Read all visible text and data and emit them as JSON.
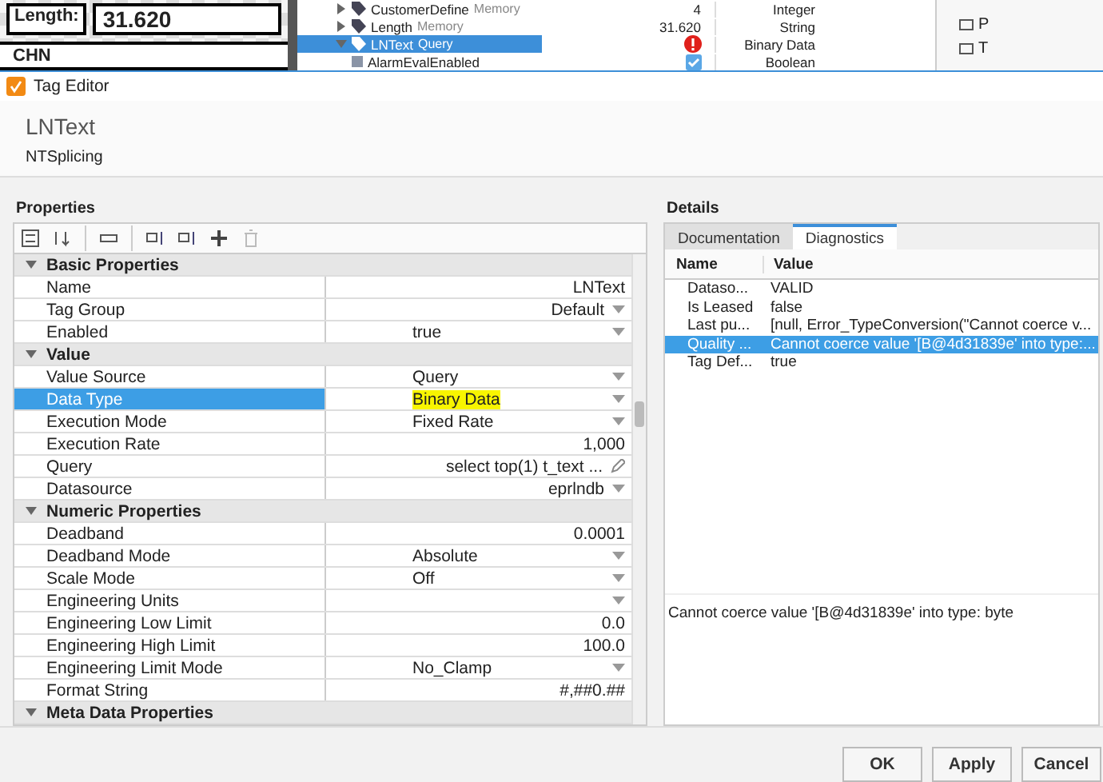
{
  "background": {
    "canvas": {
      "length_label": "Length:",
      "length_value": "31.620",
      "country": "CHN"
    },
    "tag_tree": [
      {
        "kind": "tag",
        "name": "CustomerDefine",
        "source": "Memory",
        "value": {
          "kind": "text",
          "text": "4"
        },
        "data_type": "Integer",
        "expanded": false,
        "selected": false
      },
      {
        "kind": "tag",
        "name": "Length",
        "source": "Memory",
        "value": {
          "kind": "text",
          "text": "31.620"
        },
        "data_type": "String",
        "expanded": false,
        "selected": false
      },
      {
        "kind": "tag",
        "name": "LNText",
        "source": "Query",
        "value": {
          "kind": "error"
        },
        "data_type": "Binary Data",
        "expanded": true,
        "selected": true
      },
      {
        "kind": "member",
        "name": "AlarmEvalEnabled",
        "value": {
          "kind": "checkbox",
          "checked": true
        },
        "data_type": "Boolean",
        "selected": false
      }
    ],
    "side_panel": [
      "P",
      "T"
    ]
  },
  "dialog": {
    "title": "Tag Editor",
    "tag_name": "LNText",
    "tag_path": "NTSplicing",
    "properties": {
      "title": "Properties",
      "rows": [
        {
          "kind": "section",
          "label": "Basic Properties",
          "expanded": true
        },
        {
          "kind": "text",
          "label": "Name",
          "value": "LNText",
          "selected": false,
          "highlighted": false
        },
        {
          "kind": "dropdown-right",
          "label": "Tag Group",
          "value": "Default",
          "selected": false,
          "highlighted": false
        },
        {
          "kind": "dropdown",
          "label": "Enabled",
          "value": "true",
          "selected": false,
          "highlighted": false
        },
        {
          "kind": "section",
          "label": "Value",
          "expanded": true
        },
        {
          "kind": "dropdown",
          "label": "Value Source",
          "value": "Query",
          "selected": false,
          "highlighted": false
        },
        {
          "kind": "dropdown",
          "label": "Data Type",
          "value": "Binary Data",
          "selected": true,
          "highlighted": true
        },
        {
          "kind": "dropdown",
          "label": "Execution Mode",
          "value": "Fixed Rate",
          "selected": false,
          "highlighted": false
        },
        {
          "kind": "text",
          "label": "Execution Rate",
          "value": "1,000",
          "selected": false,
          "highlighted": false
        },
        {
          "kind": "editable",
          "label": "Query",
          "value": "select  top(1) t_text ...",
          "selected": false,
          "highlighted": false
        },
        {
          "kind": "dropdown-right",
          "label": "Datasource",
          "value": "eprlndb",
          "selected": false,
          "highlighted": false
        },
        {
          "kind": "section",
          "label": "Numeric Properties",
          "expanded": true
        },
        {
          "kind": "text",
          "label": "Deadband",
          "value": "0.0001",
          "selected": false,
          "highlighted": false
        },
        {
          "kind": "dropdown",
          "label": "Deadband Mode",
          "value": "Absolute",
          "selected": false,
          "highlighted": false
        },
        {
          "kind": "dropdown",
          "label": "Scale Mode",
          "value": "Off",
          "selected": false,
          "highlighted": false
        },
        {
          "kind": "dropdown",
          "label": "Engineering Units",
          "selected": false,
          "highlighted": false
        },
        {
          "kind": "text",
          "label": "Engineering Low Limit",
          "value": "0.0",
          "selected": false,
          "highlighted": false
        },
        {
          "kind": "text",
          "label": "Engineering High Limit",
          "value": "100.0",
          "selected": false,
          "highlighted": false
        },
        {
          "kind": "dropdown",
          "label": "Engineering Limit Mode",
          "value": "No_Clamp",
          "selected": false,
          "highlighted": false
        },
        {
          "kind": "text",
          "label": "Format String",
          "value": "#,##0.##",
          "selected": false,
          "highlighted": false
        },
        {
          "kind": "section",
          "label": "Meta Data Properties",
          "expanded": true
        }
      ]
    },
    "details": {
      "title": "Details",
      "tabs": [
        {
          "label": "Documentation",
          "selected": false
        },
        {
          "label": "Diagnostics",
          "selected": true
        }
      ],
      "columns": [
        "Name",
        "Value"
      ],
      "rows": [
        {
          "name": "Dataso...",
          "value": "VALID",
          "selected": false
        },
        {
          "name": "Is Leased",
          "value": "false",
          "selected": false
        },
        {
          "name": "Last pu...",
          "value": "[null, Error_TypeConversion(\"Cannot coerce v...",
          "selected": false
        },
        {
          "name": "Quality ...",
          "value": "Cannot coerce value '[B@4d31839e' into type:...",
          "selected": true
        },
        {
          "name": "Tag Def...",
          "value": "true",
          "selected": false
        }
      ],
      "message": "Cannot coerce value '[B@4d31839e' into type: byte"
    },
    "buttons": [
      "OK",
      "Apply",
      "Cancel"
    ]
  }
}
